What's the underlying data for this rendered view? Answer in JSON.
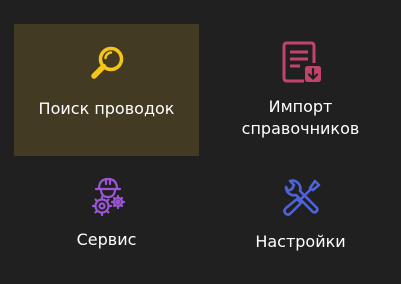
{
  "tiles": [
    {
      "label": "Поиск проводок",
      "icon": "magnifier-icon",
      "color": "#f5c518",
      "selected": true
    },
    {
      "label_line1": "Импорт",
      "label_line2": "справочников",
      "icon": "document-import-icon",
      "color": "#c2436b",
      "selected": false
    },
    {
      "label": "Сервис",
      "icon": "worker-gears-icon",
      "color": "#9a55d8",
      "selected": false
    },
    {
      "label": "Настройки",
      "icon": "wrench-screwdriver-icon",
      "color": "#4f63d8",
      "selected": false
    }
  ],
  "colors": {
    "background": "#202020",
    "selected_tile": "#433a23",
    "text": "#ffffff"
  }
}
